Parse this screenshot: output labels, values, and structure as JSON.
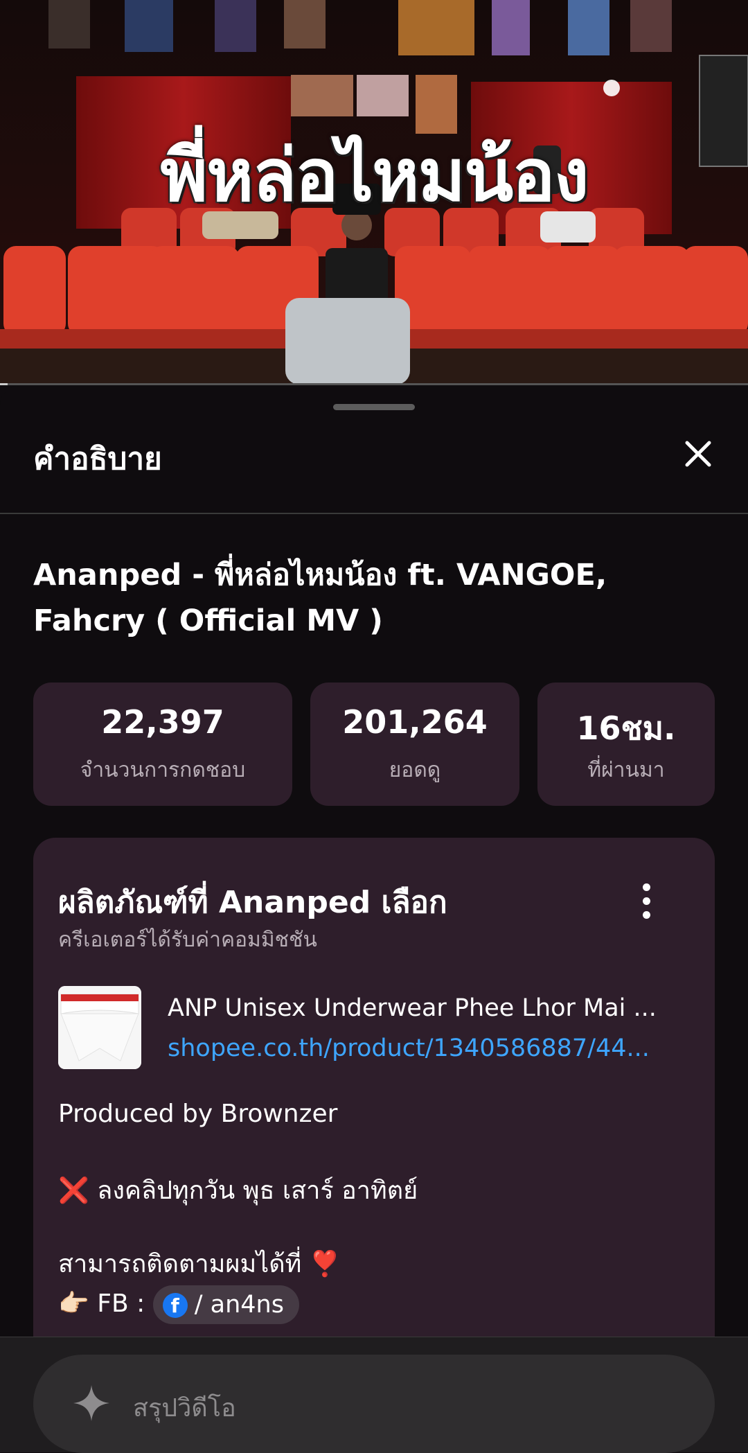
{
  "video": {
    "overlay_title": "พี่หล่อไหมน้อง",
    "progress_fraction": 0.01
  },
  "sheet": {
    "title": "คำอธิบาย",
    "close_icon": "close-icon",
    "video_title": "Ananped - พี่หล่อไหมน้อง ft. VANGOE, Fahcry ( Official MV )",
    "stats": [
      {
        "value": "22,397",
        "label": "จำนวนการกดชอบ"
      },
      {
        "value": "201,264",
        "label": "ยอดดู"
      },
      {
        "value": "16ชม.",
        "label": "ที่ผ่านมา"
      }
    ],
    "shopping": {
      "title": "ผลิตภัณฑ์ที่ Ananped เลือก",
      "subtitle": "ครีเอเตอร์ได้รับค่าคอมมิชชัน",
      "product_name": "ANP Unisex Underwear Phee Lhor Mai ...",
      "product_link": "shopee.co.th/product/1340586887/44..."
    },
    "description": {
      "produced_by": "Produced by Brownzer",
      "schedule_emoji": "❌",
      "schedule": "ลงคลิปทุกวัน พุธ เสาร์ อาทิตย์",
      "follow": "สามารถติดตามผมได้ที่",
      "follow_emoji": "❣️",
      "fb_emoji": "👉🏻",
      "fb_label": "FB :",
      "fb_icon": "f",
      "fb_handle": "/ an4ns"
    }
  },
  "bottom": {
    "summarize_label": "สรุปวิดีโอ",
    "icon": "sparkle-icon"
  }
}
